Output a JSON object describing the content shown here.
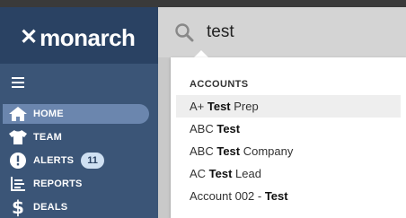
{
  "brand": {
    "name": "monarch",
    "accent": "#3b5577",
    "active_bg": "#6b86ae"
  },
  "search": {
    "value": "test",
    "placeholder": ""
  },
  "sidebar": {
    "items": [
      {
        "label": "HOME",
        "icon": "home-icon",
        "active": true
      },
      {
        "label": "TEAM",
        "icon": "shirt-icon"
      },
      {
        "label": "ALERTS",
        "icon": "alert-icon",
        "badge": "11"
      },
      {
        "label": "REPORTS",
        "icon": "reports-icon"
      },
      {
        "label": "DEALS",
        "icon": "dollar-icon"
      }
    ]
  },
  "dropdown": {
    "section": "ACCOUNTS",
    "results": [
      {
        "pre": "A+ ",
        "match": "Test",
        "post": " Prep"
      },
      {
        "pre": "ABC ",
        "match": "Test",
        "post": ""
      },
      {
        "pre": "ABC ",
        "match": "Test",
        "post": " Company"
      },
      {
        "pre": "AC ",
        "match": "Test",
        "post": " Lead"
      },
      {
        "pre": "Account 002 - ",
        "match": "Test",
        "post": ""
      }
    ]
  }
}
